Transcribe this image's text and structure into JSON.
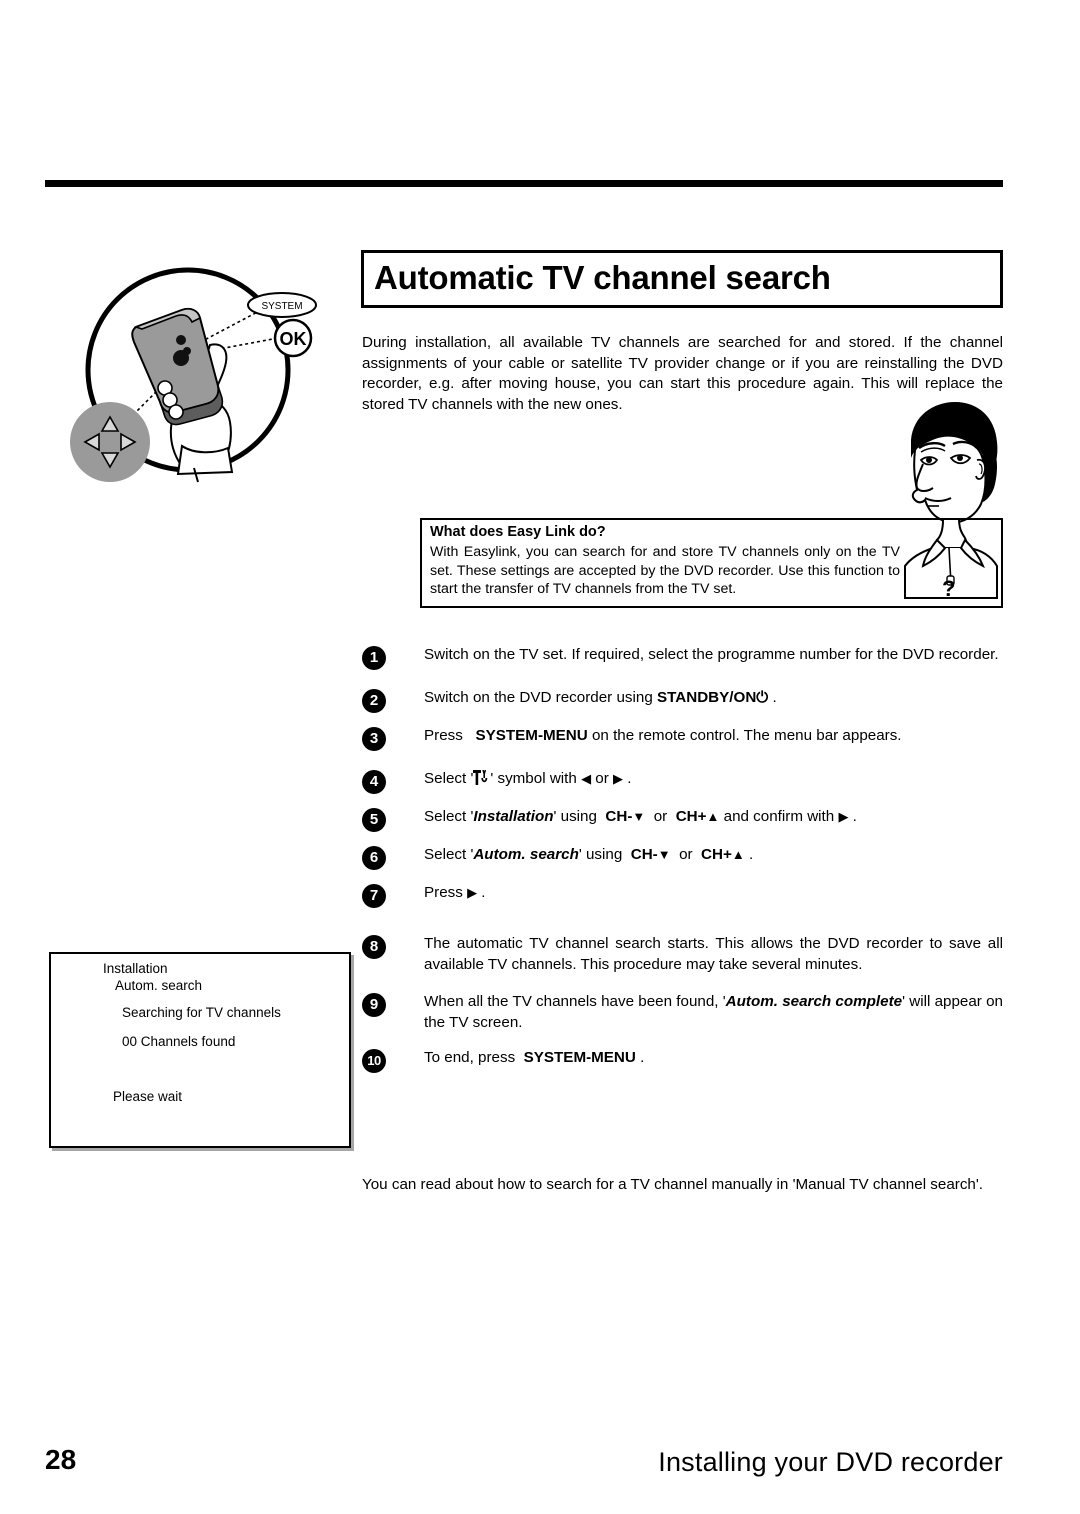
{
  "page": {
    "number": "28",
    "footer_title": "Installing your DVD recorder"
  },
  "title": "Automatic TV channel search",
  "intro": "During installation, all available TV channels are searched for and stored. If the channel assignments of your cable or satellite TV provider change or if you are reinstalling the DVD recorder, e.g. after moving house, you can start this procedure again. This will replace the stored TV channels with the new ones.",
  "easylink": {
    "heading": "What does Easy Link do?",
    "body": "With Easylink, you can search for and store TV channels only on the TV set. These settings are accepted by the DVD recorder. Use this function to start the transfer of TV channels from the TV set.",
    "question_mark": "?"
  },
  "steps": [
    {
      "number": "1",
      "text": "Switch on the TV set. If required, select the programme number for the DVD recorder."
    },
    {
      "number": "2",
      "text": "Switch on the DVD recorder using STANDBY/ON ⏻ ."
    },
    {
      "number": "3",
      "text": "Press SYSTEM-MENU on the remote control. The menu bar appears."
    },
    {
      "number": "4",
      "text": "Select '⚒' symbol with ◀ or ▶ ."
    },
    {
      "number": "5",
      "text": "Select 'Installation' using CH- ▼ or CH+ ▲ and confirm with ▶ ."
    },
    {
      "number": "6",
      "text": "Select 'Autom. search' using CH- ▼ or CH+ ▲ ."
    },
    {
      "number": "7",
      "text": "Press ▶ ."
    },
    {
      "number": "8",
      "text": "The automatic TV channel search starts. This allows the DVD recorder to save all available TV channels. This procedure may take several minutes."
    },
    {
      "number": "9",
      "text": "When all the TV channels have been found, 'Autom. search complete' will appear on the TV screen."
    },
    {
      "number": "10",
      "text": "To end, press SYSTEM-MENU ."
    }
  ],
  "step_keys": {
    "standby_on": "STANDBY/ON",
    "system_menu": "SYSTEM-MENU",
    "ch_minus": "CH-",
    "ch_plus": "CH+",
    "installation": "Installation",
    "autom_search": "Autom. search",
    "autom_search_complete_a": "Autom. search",
    "autom_search_complete_b": "complete",
    "select": "Select",
    "press": "Press",
    "using": "using",
    "with": "with",
    "or": "or",
    "symbol": "symbol",
    "and_confirm_with": "and confirm with",
    "to_end_press": "To end, press",
    "switch_on_dvd": "Switch on the DVD recorder using",
    "press_on_remote": "on the remote control. The menu bar appears.",
    "will_appear": "' will appear on the TV screen.",
    "when_all_found": "When all the TV channels have been found, '",
    "period": "."
  },
  "tv_screen": {
    "line1": "Installation",
    "line2": "Autom. search",
    "line3": "Searching for TV channels",
    "line4": "00 Channels found",
    "line5": "Please wait"
  },
  "closing_note": "You can read about how to search for a TV channel manually in 'Manual TV channel search'.",
  "illustration": {
    "remote_label_system": "SYSTEM",
    "remote_label_ok": "OK"
  },
  "colors": {
    "ink": "#000000",
    "paper": "#ffffff",
    "remote_gray": "#9a9a9a",
    "remote_gray_light": "#c4c4c4"
  }
}
